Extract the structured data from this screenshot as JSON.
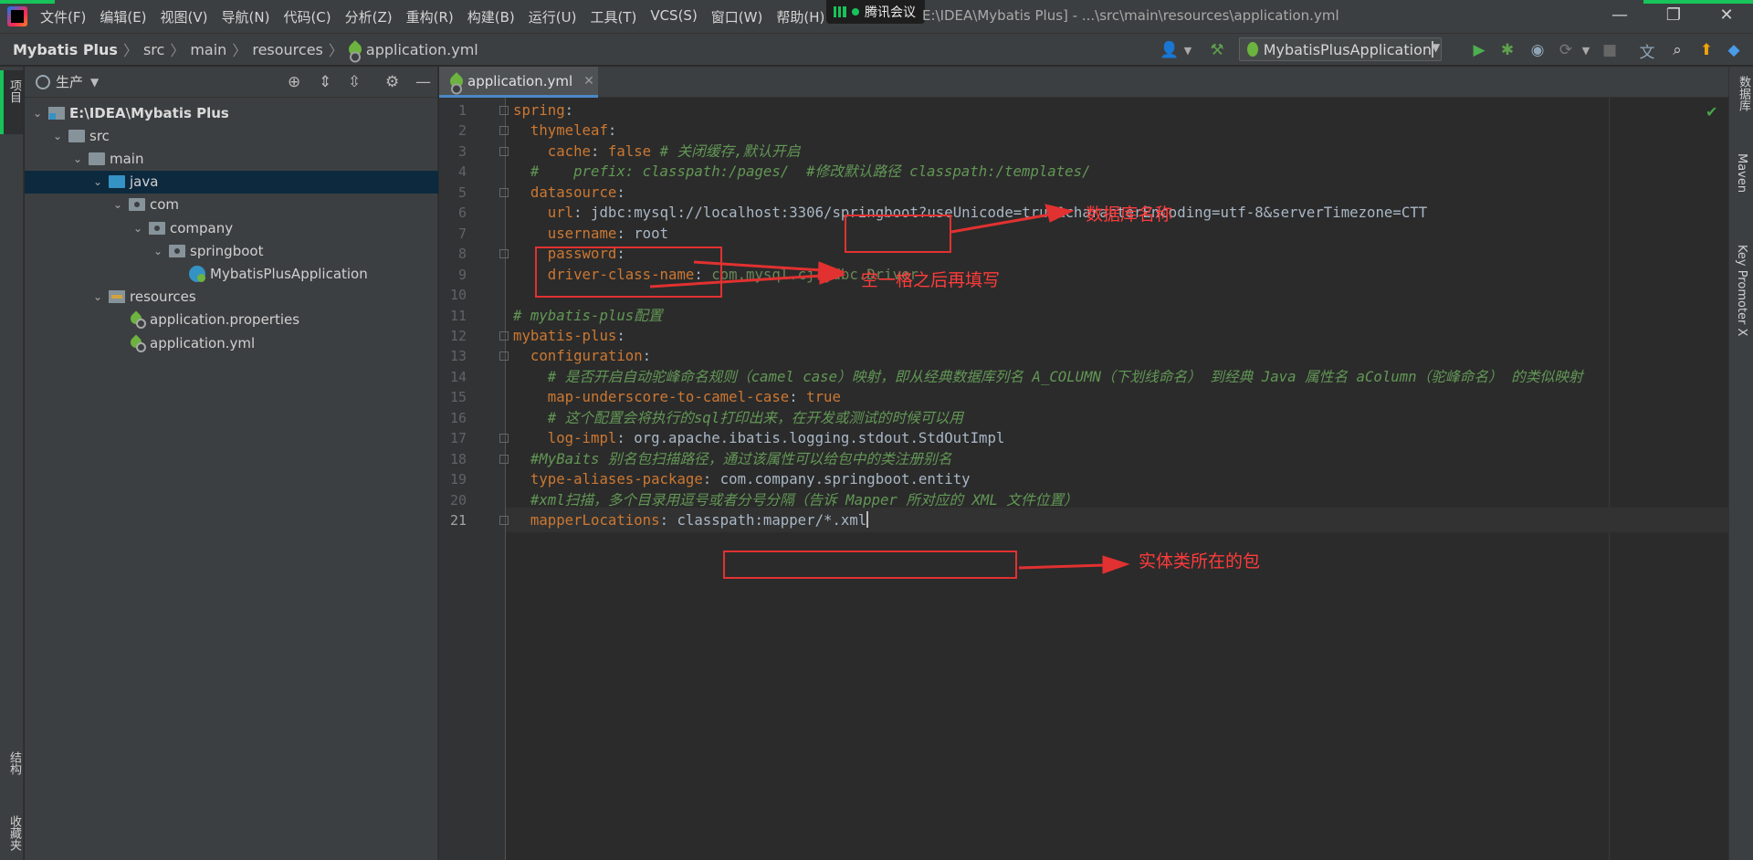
{
  "menubar": {
    "items": [
      "文件(F)",
      "编辑(E)",
      "视图(V)",
      "导航(N)",
      "代码(C)",
      "分析(Z)",
      "重构(R)",
      "构建(B)",
      "运行(U)",
      "工具(T)",
      "VCS(S)",
      "窗口(W)",
      "帮助(H)"
    ],
    "window_title": "E:\\IDEA\\Mybatis Plus] - ...\\src\\main\\resources\\application.yml",
    "meeting_badge": "腾讯会议",
    "window_controls": [
      "—",
      "❐",
      "✕"
    ]
  },
  "navbar": {
    "breadcrumbs": [
      "Mybatis Plus",
      "src",
      "main",
      "resources",
      "application.yml"
    ],
    "run_config": "MybatisPlusApplication"
  },
  "left_strip": {
    "project_tab": "项目",
    "structure_tab": "结构",
    "favorites_tab": "收藏夹"
  },
  "right_strip": {
    "database_tab": "数据库",
    "maven_tab": "Maven",
    "key_promoter_tab": "Key Promoter X"
  },
  "project_panel": {
    "title": "生产",
    "tree": [
      {
        "label": "E:\\IDEA\\Mybatis Plus",
        "depth": 0,
        "icon": "module",
        "arrow": "⌄",
        "bold": true
      },
      {
        "label": "src",
        "depth": 1,
        "icon": "folder",
        "arrow": "⌄"
      },
      {
        "label": "main",
        "depth": 2,
        "icon": "folder",
        "arrow": "⌄"
      },
      {
        "label": "java",
        "depth": 3,
        "icon": "folder-blue",
        "arrow": "⌄",
        "selected": true
      },
      {
        "label": "com",
        "depth": 4,
        "icon": "folder-pkg",
        "arrow": "⌄"
      },
      {
        "label": "company",
        "depth": 5,
        "icon": "folder-pkg",
        "arrow": "⌄"
      },
      {
        "label": "springboot",
        "depth": 6,
        "icon": "folder-pkg",
        "arrow": "⌄"
      },
      {
        "label": "MybatisPlusApplication",
        "depth": 7,
        "icon": "spring-class",
        "arrow": ""
      },
      {
        "label": "resources",
        "depth": 3,
        "icon": "folder-res",
        "arrow": "⌄"
      },
      {
        "label": "application.properties",
        "depth": 4,
        "icon": "leaf",
        "arrow": ""
      },
      {
        "label": "application.yml",
        "depth": 4,
        "icon": "leaf",
        "arrow": ""
      }
    ]
  },
  "editor": {
    "tab_label": "application.yml",
    "current_line": 21,
    "lines": [
      [
        [
          "k",
          "spring"
        ],
        [
          "p",
          ":"
        ]
      ],
      [
        [
          "p",
          "  "
        ],
        [
          "k",
          "thymeleaf"
        ],
        [
          "p",
          ":"
        ]
      ],
      [
        [
          "p",
          "    "
        ],
        [
          "k",
          "cache"
        ],
        [
          "p",
          ": "
        ],
        [
          "k",
          "false "
        ],
        [
          "c",
          "# 关闭缓存,默认开启"
        ]
      ],
      [
        [
          "c",
          "  #    prefix: classpath:/pages/  #修改默认路径 classpath:/templates/"
        ]
      ],
      [
        [
          "p",
          "  "
        ],
        [
          "k",
          "datasource"
        ],
        [
          "p",
          ":"
        ]
      ],
      [
        [
          "p",
          "    "
        ],
        [
          "k",
          "url"
        ],
        [
          "p",
          ": jdbc:mysql://localhost:3306/springboot?useUnicode=true&characterEncoding=utf-8&serverTimezone=CTT"
        ]
      ],
      [
        [
          "p",
          "    "
        ],
        [
          "k",
          "username"
        ],
        [
          "p",
          ": root"
        ]
      ],
      [
        [
          "p",
          "    "
        ],
        [
          "k",
          "password"
        ],
        [
          "p",
          ":"
        ]
      ],
      [
        [
          "p",
          "    "
        ],
        [
          "k",
          "driver-class-name"
        ],
        [
          "p",
          ": "
        ],
        [
          "s",
          "com.mysql.cj.jdbc.Driver"
        ]
      ],
      [],
      [
        [
          "c",
          "# mybatis-plus配置"
        ]
      ],
      [
        [
          "k",
          "mybatis-plus"
        ],
        [
          "p",
          ":"
        ]
      ],
      [
        [
          "p",
          "  "
        ],
        [
          "k",
          "configuration"
        ],
        [
          "p",
          ":"
        ]
      ],
      [
        [
          "p",
          "    "
        ],
        [
          "c",
          "# 是否开启自动驼峰命名规则（camel case）映射，即从经典数据库列名 A_COLUMN（下划线命名） 到经典 Java 属性名 aColumn（驼峰命名） 的类似映射"
        ]
      ],
      [
        [
          "p",
          "    "
        ],
        [
          "k",
          "map-underscore-to-camel-case"
        ],
        [
          "p",
          ": "
        ],
        [
          "k",
          "true"
        ]
      ],
      [
        [
          "p",
          "    "
        ],
        [
          "c",
          "# 这个配置会将执行的sql打印出来，在开发或测试的时候可以用"
        ]
      ],
      [
        [
          "p",
          "    "
        ],
        [
          "k",
          "log-impl"
        ],
        [
          "p",
          ": org.apache.ibatis.logging.stdout.StdOutImpl"
        ]
      ],
      [
        [
          "p",
          "  "
        ],
        [
          "c",
          "#MyBaits 别名包扫描路径，通过该属性可以给包中的类注册别名"
        ]
      ],
      [
        [
          "p",
          "  "
        ],
        [
          "k",
          "type-aliases-package"
        ],
        [
          "p",
          ": com.company.springboot.entity"
        ]
      ],
      [
        [
          "p",
          "  "
        ],
        [
          "c",
          "#xml扫描，多个目录用逗号或者分号分隔（告诉 Mapper 所对应的 XML 文件位置）"
        ]
      ],
      [
        [
          "p",
          "  "
        ],
        [
          "k",
          "mapperLocations"
        ],
        [
          "p",
          ": classpath:mapper/*.xml"
        ]
      ]
    ]
  },
  "annotations": {
    "db_name": "数据库名称",
    "fill_after_space": "空一格之后再填写",
    "entity_package": "实体类所在的包",
    "color": "#e23131"
  }
}
